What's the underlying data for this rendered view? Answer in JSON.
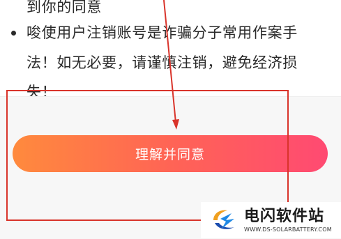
{
  "warning": {
    "line_partial": "到你的同意",
    "line_1": "唆使用户注销账号是诈骗分子常用作案手",
    "line_2": "法！如无必要，请谨慎注销，避免经济损",
    "line_3": "失！"
  },
  "agree_button": {
    "label": "理解并同意"
  },
  "watermark": {
    "title": "电闪软件站",
    "url": "WWW.DS-SOLARBATTERY.COM"
  },
  "colors": {
    "button_gradient_start": "#ff8a3d",
    "button_gradient_end": "#ff4a72",
    "annotation_red": "#d9342b"
  },
  "icons": {
    "watermark_logo": "ds-logo-icon"
  }
}
